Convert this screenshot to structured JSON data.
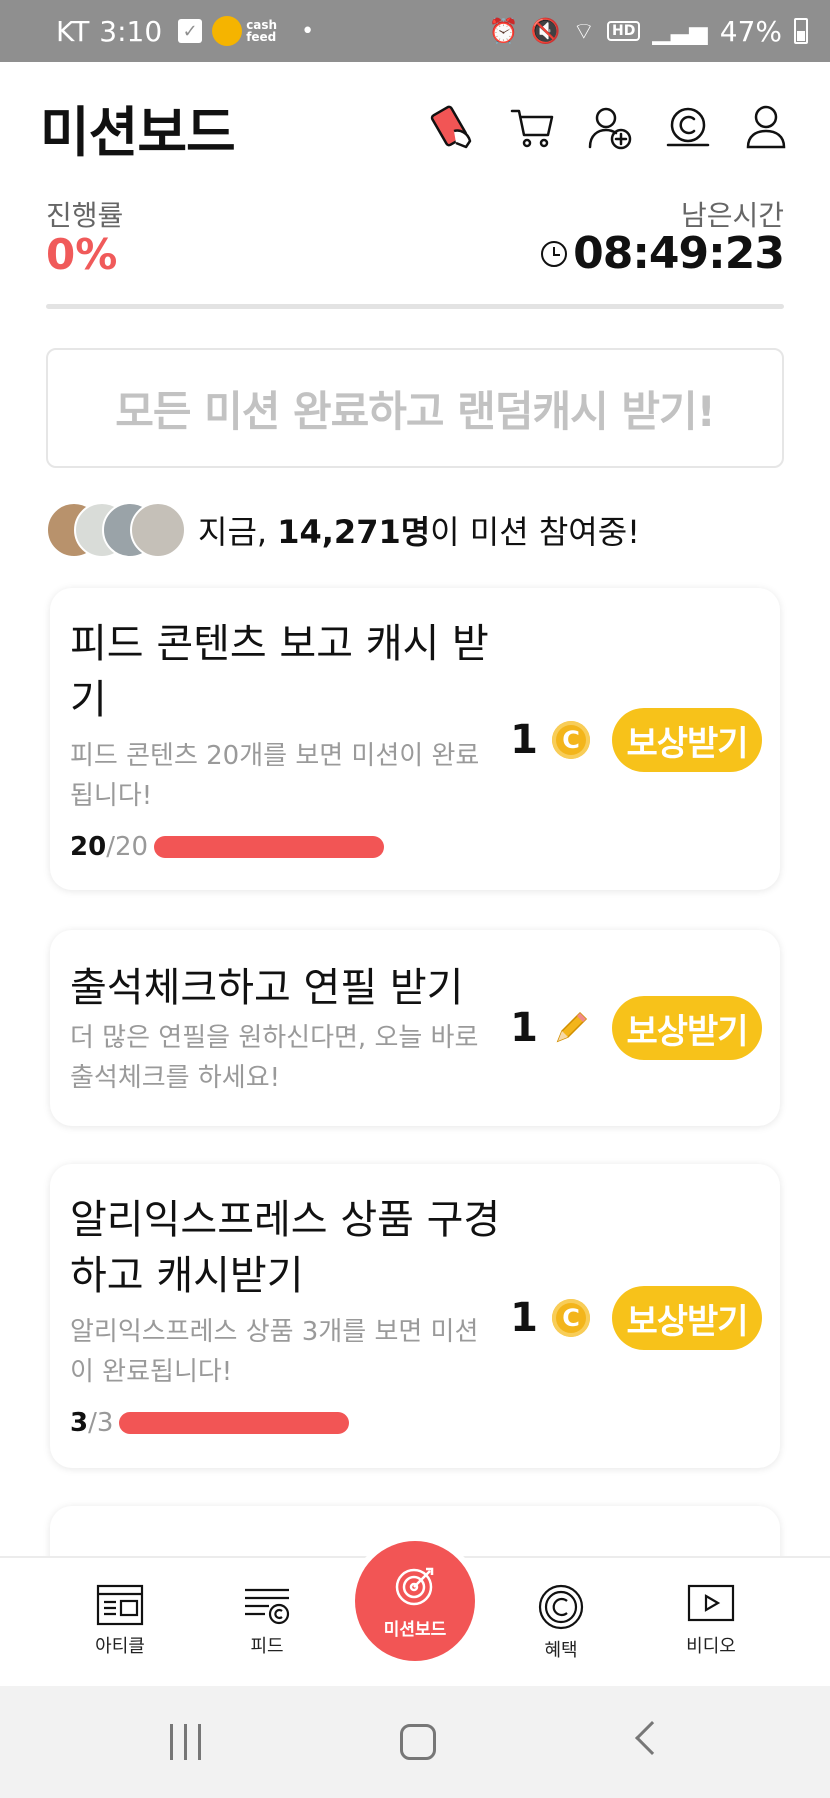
{
  "status_bar": {
    "carrier": "KT",
    "time": "3:10",
    "cashfeed_label_1": "cash",
    "cashfeed_label_2": "feed",
    "dot": "•",
    "hd": "HD",
    "battery": "47%"
  },
  "header": {
    "title": "미션보드"
  },
  "progress": {
    "label": "진행률",
    "value": "0%",
    "time_label": "남은시간",
    "time_value": "08:49:23"
  },
  "banner": {
    "text": "모든 미션 완료하고 랜덤캐시 받기!"
  },
  "participants": {
    "prefix": "지금, ",
    "count": "14,271명",
    "suffix": "이 미션 참여중!"
  },
  "missions": [
    {
      "title": "피드 콘텐츠 보고 캐시 받기",
      "desc": "피드 콘텐츠 20개를 보면 미션이 완료됩니다!",
      "done": "20",
      "total": "/20",
      "progress": 1.0,
      "reward": "1",
      "reward_icon": "coin-icon",
      "button": "보상받기"
    },
    {
      "title": "출석체크하고 연필 받기",
      "desc": "더 많은 연필을 원하신다면, 오늘 바로 출석체크를 하세요!",
      "reward": "1",
      "reward_icon": "pencil-icon",
      "button": "보상받기"
    },
    {
      "title": "알리익스프레스 상품 구경하고 캐시받기",
      "desc": "알리익스프레스 상품 3개를 보면 미션이 완료됩니다!",
      "done": "3",
      "total": "/3",
      "progress": 1.0,
      "reward": "1",
      "reward_icon": "coin-icon",
      "button": "보상받기"
    }
  ],
  "bottom_nav": {
    "article": "아티클",
    "feed": "피드",
    "missionboard": "미션보드",
    "benefit": "혜택",
    "video": "비디오"
  },
  "coin_symbol": "C",
  "colors": {
    "accent_red": "#f25555",
    "reward_yellow": "#f7c21a",
    "coin_gold": "#f3b51b"
  }
}
